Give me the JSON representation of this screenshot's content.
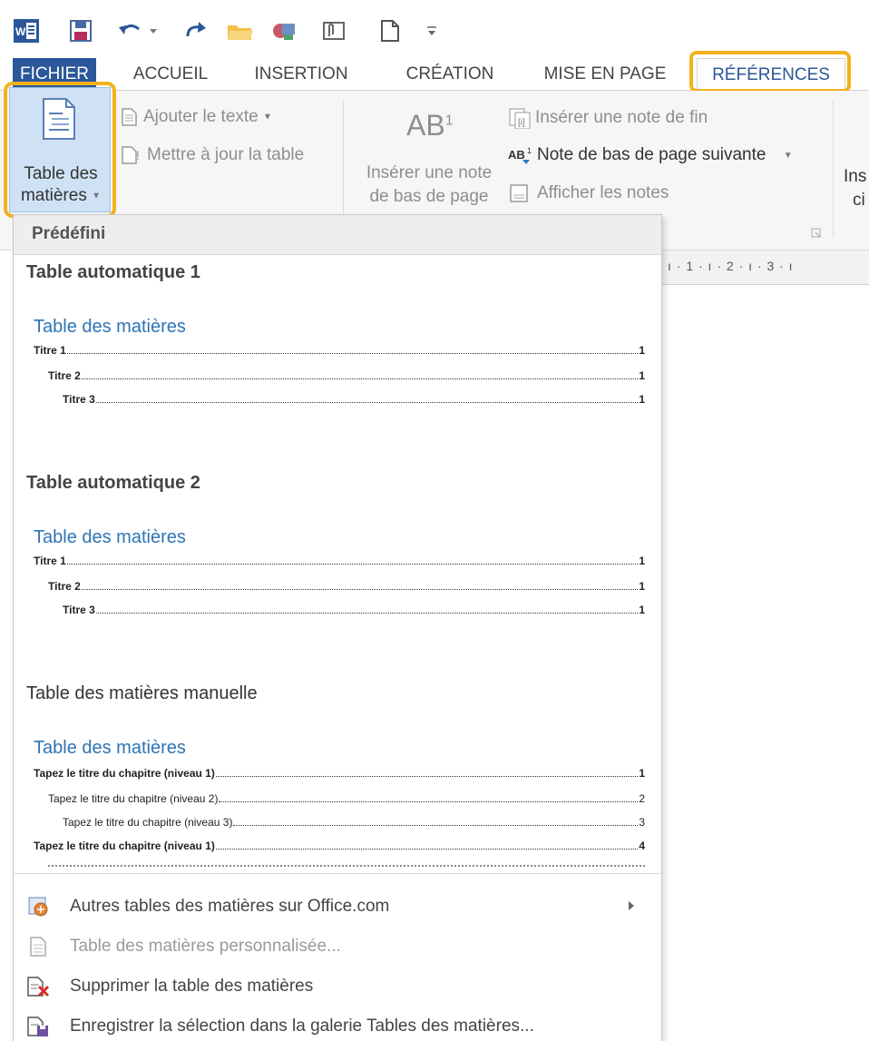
{
  "quick_access": {
    "icons": [
      "word-icon",
      "save-icon",
      "undo-icon",
      "redo-icon",
      "open-folder-icon",
      "touch-mode-icon",
      "attach-icon",
      "new-document-icon",
      "customize-qat-icon"
    ]
  },
  "tabs": {
    "fichier": "FICHIER",
    "accueil": "ACCUEIL",
    "insertion": "INSERTION",
    "creation": "CRÉATION",
    "mise_en_page": "MISE EN PAGE",
    "references": "RÉFÉRENCES"
  },
  "ribbon": {
    "toc_button": {
      "line1": "Table des",
      "line2": "matières"
    },
    "ajouter_texte": "Ajouter le texte",
    "mettre_a_jour": "Mettre à jour la table",
    "ab_label": "AB",
    "ab_sup": "1",
    "inserer_note": {
      "line1": "Insérer une note",
      "line2": "de bas de page"
    },
    "inserer_note_fin": "Insérer une note de fin",
    "note_suivante": "Note de bas de page suivante",
    "afficher_notes": "Afficher les notes",
    "partial_label": {
      "line1": "Ins",
      "line2": "ci"
    }
  },
  "ruler": {
    "marks": "ı · 1 · ı · 2 · ı · 3 · ı"
  },
  "gallery": {
    "header": "Prédéfini",
    "sections": [
      {
        "title": "Table automatique 1",
        "toc_heading": "Table des matières",
        "entries": [
          {
            "text": "Titre 1",
            "page": "1"
          },
          {
            "text": "Titre 2",
            "page": "1"
          },
          {
            "text": "Titre 3",
            "page": "1"
          }
        ]
      },
      {
        "title": "Table automatique 2",
        "toc_heading": "Table des matières",
        "entries": [
          {
            "text": "Titre 1",
            "page": "1"
          },
          {
            "text": "Titre 2",
            "page": "1"
          },
          {
            "text": "Titre 3",
            "page": "1"
          }
        ]
      },
      {
        "title": "Table des matières manuelle",
        "toc_heading": "Table des matières",
        "entries": [
          {
            "text": "Tapez le titre du chapitre (niveau 1)",
            "page": "1"
          },
          {
            "text": "Tapez le titre du chapitre (niveau 2)",
            "page": "2"
          },
          {
            "text": "Tapez le titre du chapitre (niveau 3)",
            "page": "3"
          },
          {
            "text": "Tapez le titre du chapitre (niveau 1)",
            "page": "4"
          }
        ]
      }
    ],
    "menu": [
      {
        "label": "Autres tables des matières sur Office.com",
        "icon": "office-com-icon"
      },
      {
        "label": "Table des matières personnalisée...",
        "icon": "custom-toc-icon"
      },
      {
        "label": "Supprimer la table des matières",
        "icon": "delete-toc-icon"
      },
      {
        "label": "Enregistrer la sélection dans la galerie Tables des matières...",
        "icon": "save-to-gallery-icon"
      }
    ]
  },
  "colors": {
    "accent": "#2b579a",
    "highlight": "#f2b21c",
    "toc_heading": "#2e74b5"
  }
}
